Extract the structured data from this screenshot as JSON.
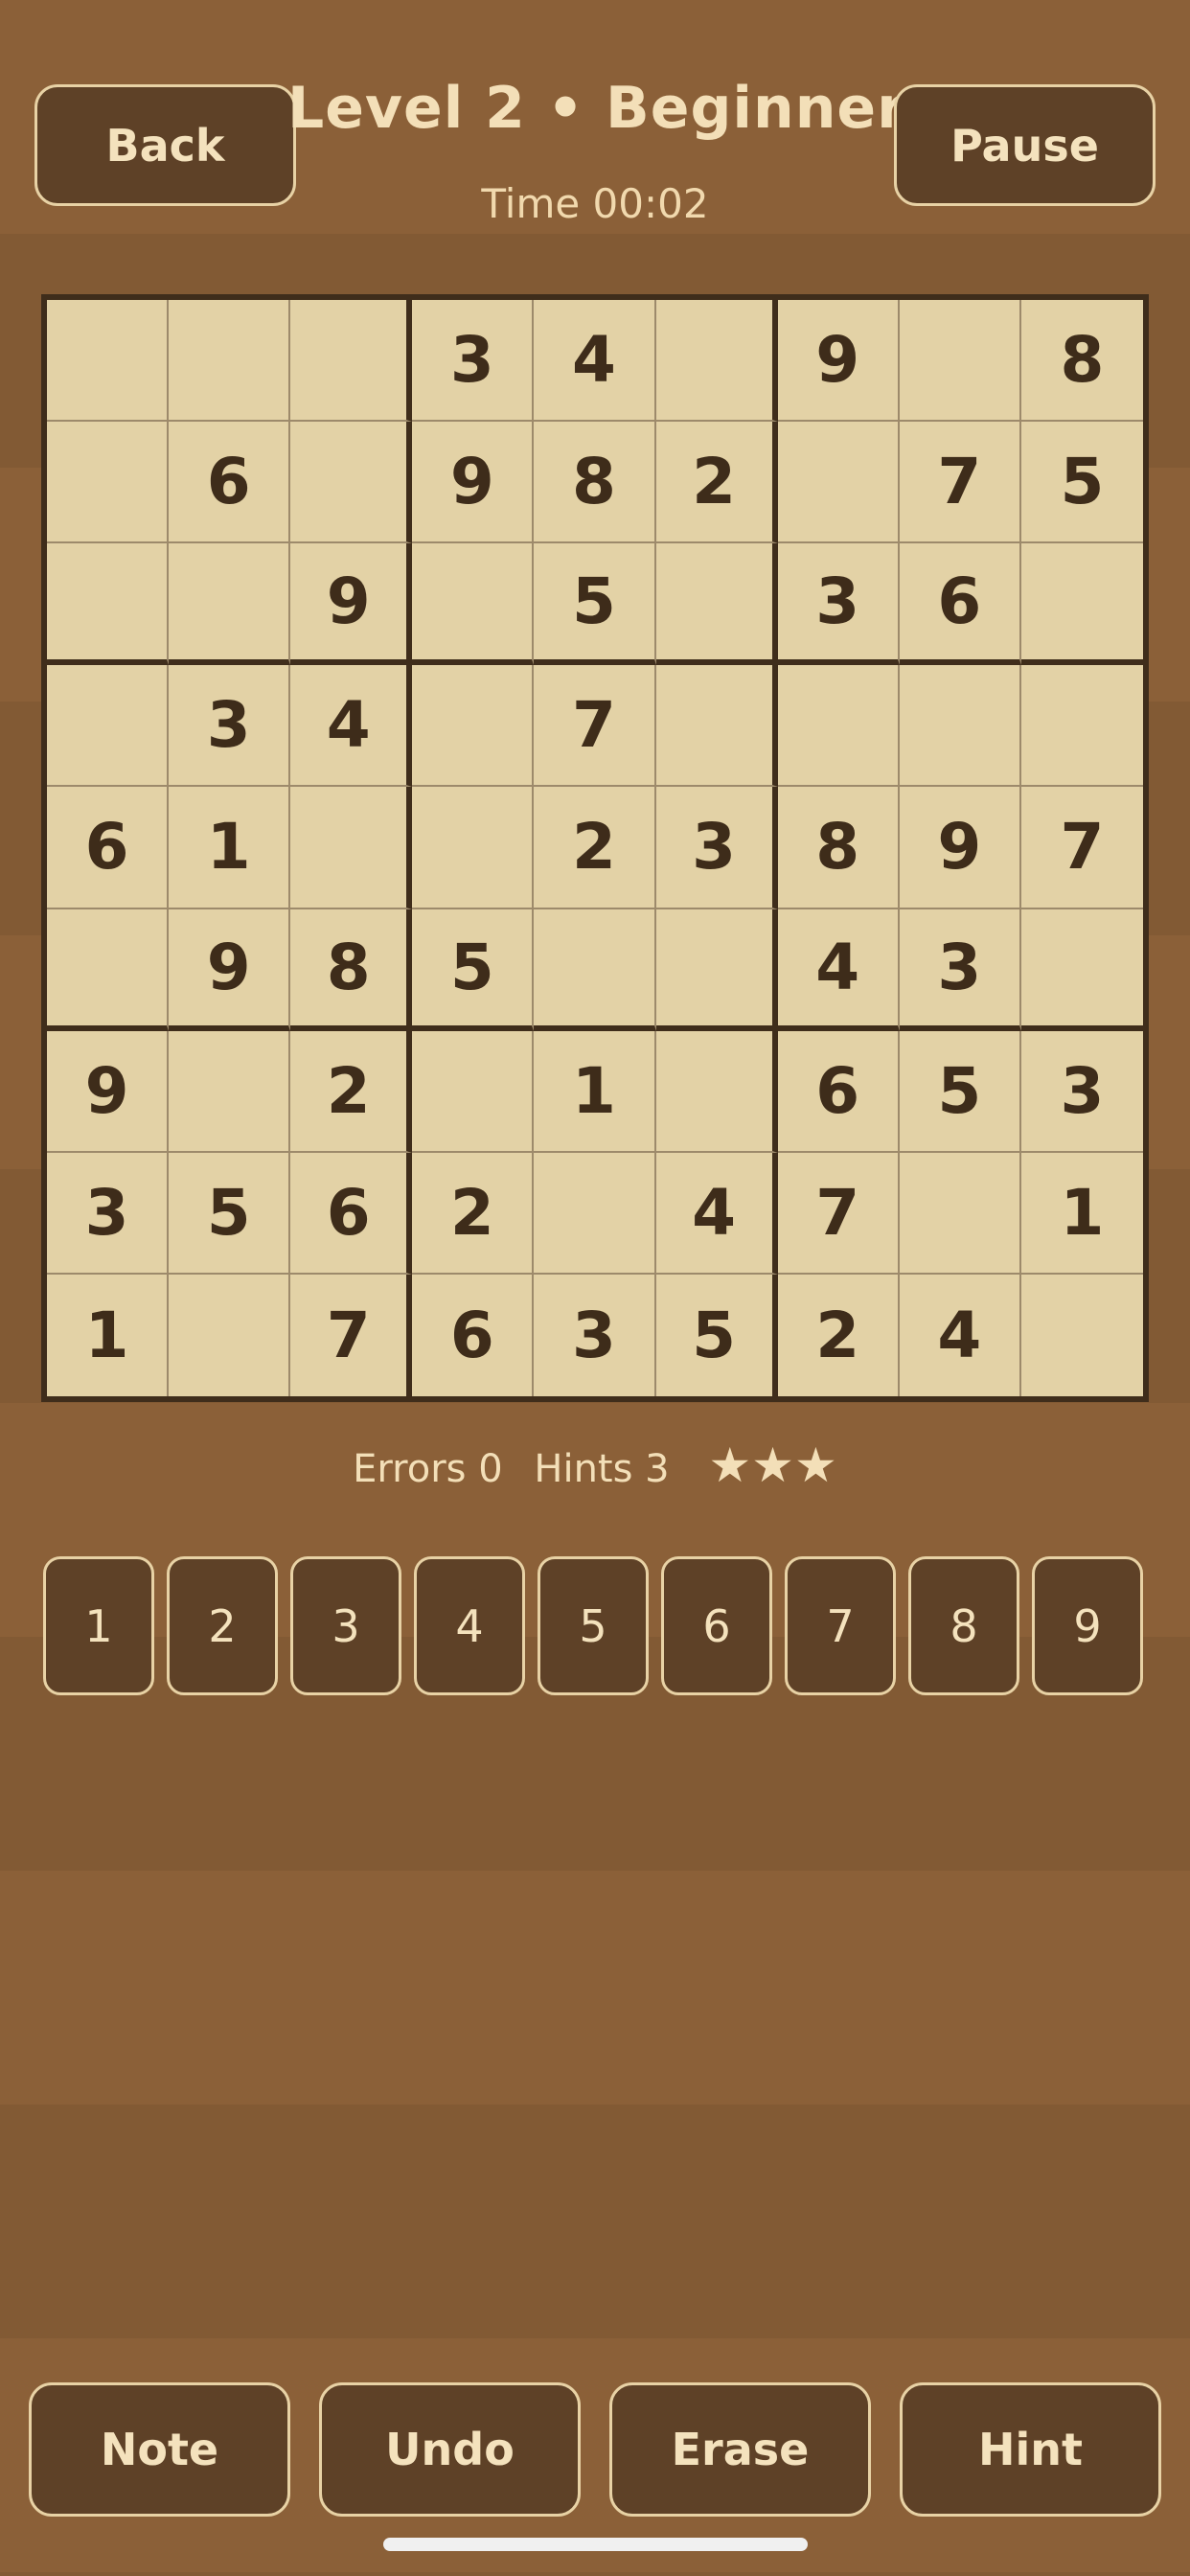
{
  "header": {
    "back_label": "Back",
    "title": "Level 2 • Beginner",
    "pause_label": "Pause",
    "time_text": "Time 00:02"
  },
  "board": {
    "rows": [
      [
        "",
        "",
        "",
        "3",
        "4",
        "",
        "9",
        "",
        "8"
      ],
      [
        "",
        "6",
        "",
        "9",
        "8",
        "2",
        "",
        "7",
        "5"
      ],
      [
        "",
        "",
        "9",
        "",
        "5",
        "",
        "3",
        "6",
        ""
      ],
      [
        "",
        "3",
        "4",
        "",
        "7",
        "",
        "",
        "",
        ""
      ],
      [
        "6",
        "1",
        "",
        "",
        "2",
        "3",
        "8",
        "9",
        "7"
      ],
      [
        "",
        "9",
        "8",
        "5",
        "",
        "",
        "4",
        "3",
        ""
      ],
      [
        "9",
        "",
        "2",
        "",
        "1",
        "",
        "6",
        "5",
        "3"
      ],
      [
        "3",
        "5",
        "6",
        "2",
        "",
        "4",
        "7",
        "",
        "1"
      ],
      [
        "1",
        "",
        "7",
        "6",
        "3",
        "5",
        "2",
        "4",
        ""
      ]
    ]
  },
  "stats": {
    "errors": "Errors 0",
    "hints": "Hints 3",
    "stars": "★★★"
  },
  "numpad": [
    "1",
    "2",
    "3",
    "4",
    "5",
    "6",
    "7",
    "8",
    "9"
  ],
  "actions": {
    "note_label": "Note",
    "undo_label": "Undo",
    "erase_label": "Erase",
    "hint_label": "Hint"
  },
  "colors": {
    "background": "#8b6038",
    "button": "#5e4127",
    "button_border": "#e8d2a5",
    "board": "#e3d2a6",
    "digit": "#3e2c1a",
    "text_light": "#f3dfb8"
  }
}
